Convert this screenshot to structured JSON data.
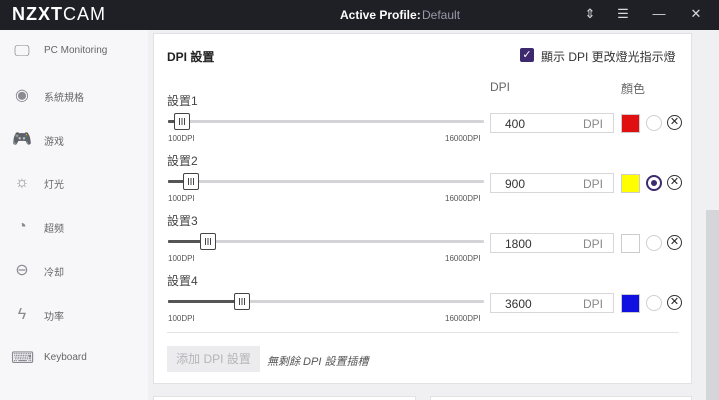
{
  "titlebar": {
    "logo_bold": "NZXT",
    "logo_light": "CAM",
    "active_profile_label": "Active Profile:",
    "active_profile_value": "Default",
    "icons": [
      "sort-icon",
      "menu-icon",
      "minimize-icon",
      "close-icon"
    ]
  },
  "sidebar": {
    "items": [
      {
        "label": "PC Monitoring",
        "icon": "monitor-icon"
      },
      {
        "label": "系統規格",
        "icon": "eye-icon"
      },
      {
        "label": "游戏",
        "icon": "gamepad-icon"
      },
      {
        "label": "灯光",
        "icon": "sun-icon"
      },
      {
        "label": "超频",
        "icon": "speedometer-icon"
      },
      {
        "label": "冷却",
        "icon": "fan-icon"
      },
      {
        "label": "功率",
        "icon": "power-icon"
      },
      {
        "label": "Keyboard",
        "icon": "keyboard-icon"
      }
    ]
  },
  "panel": {
    "title": "DPI 設置",
    "indicator_checkbox": {
      "label": "顯示 DPI 更改燈光指示燈",
      "checked": true
    },
    "col_dpi": "DPI",
    "col_color": "顏色",
    "slider_min_label": "100DPI",
    "slider_max_label": "16000DPI",
    "slider_min": 100,
    "slider_max": 16000,
    "rows": [
      {
        "label": "設置1",
        "dpi": "400",
        "unit": "DPI",
        "color": "#e01010",
        "selected": false
      },
      {
        "label": "設置2",
        "dpi": "900",
        "unit": "DPI",
        "color": "#ffff00",
        "selected": true
      },
      {
        "label": "設置3",
        "dpi": "1800",
        "unit": "DPI",
        "color": "#ffffff",
        "selected": false
      },
      {
        "label": "設置4",
        "dpi": "3600",
        "unit": "DPI",
        "color": "#1010e0",
        "selected": false
      }
    ],
    "add_button": "添加 DPI 設置",
    "add_note": "無剩餘 DPI 設置插槽"
  },
  "accent": "#3d2a6e"
}
